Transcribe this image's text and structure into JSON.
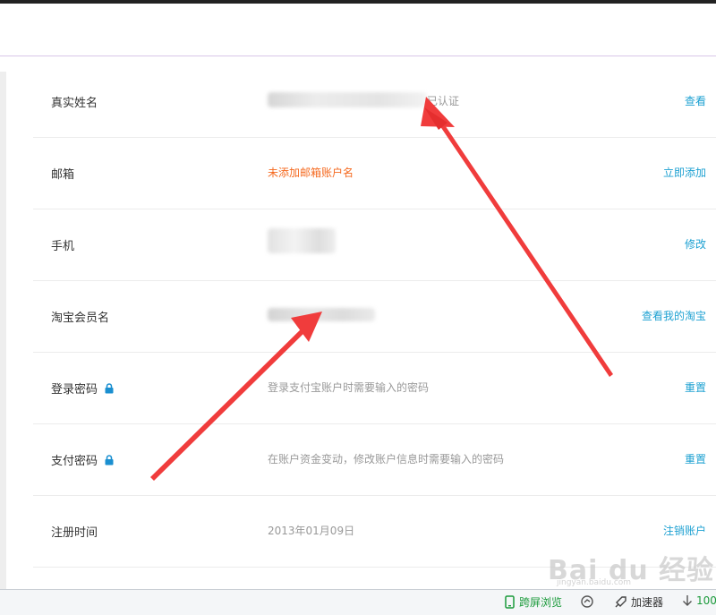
{
  "rows": [
    {
      "label": "真实姓名",
      "value": "已认证",
      "action": "查看"
    },
    {
      "label": "邮箱",
      "value": "未添加邮箱账户名",
      "action": "立即添加"
    },
    {
      "label": "手机",
      "value": "",
      "action": "修改"
    },
    {
      "label": "淘宝会员名",
      "value": "",
      "action": "查看我的淘宝"
    },
    {
      "label": "登录密码",
      "value": "登录支付宝账户时需要输入的密码",
      "action": "重置",
      "icon": "lock-icon"
    },
    {
      "label": "支付密码",
      "value": "在账户资金变动，修改账户信息时需要输入的密码",
      "action": "重置",
      "icon": "lock-icon"
    },
    {
      "label": "注册时间",
      "value": "2013年01月09日",
      "action": "注销账户"
    }
  ],
  "colors": {
    "accent": "#1ea1d2",
    "warning": "#f56a20",
    "arrow": "#f03c3c",
    "lock": "#1a8fd0"
  },
  "statusbar": {
    "cross_screen": "跨屏浏览",
    "accelerator": "加速器",
    "download": "100"
  },
  "watermark": {
    "text": "Bai du 经验",
    "sub": "jingyan.baidu.com"
  }
}
